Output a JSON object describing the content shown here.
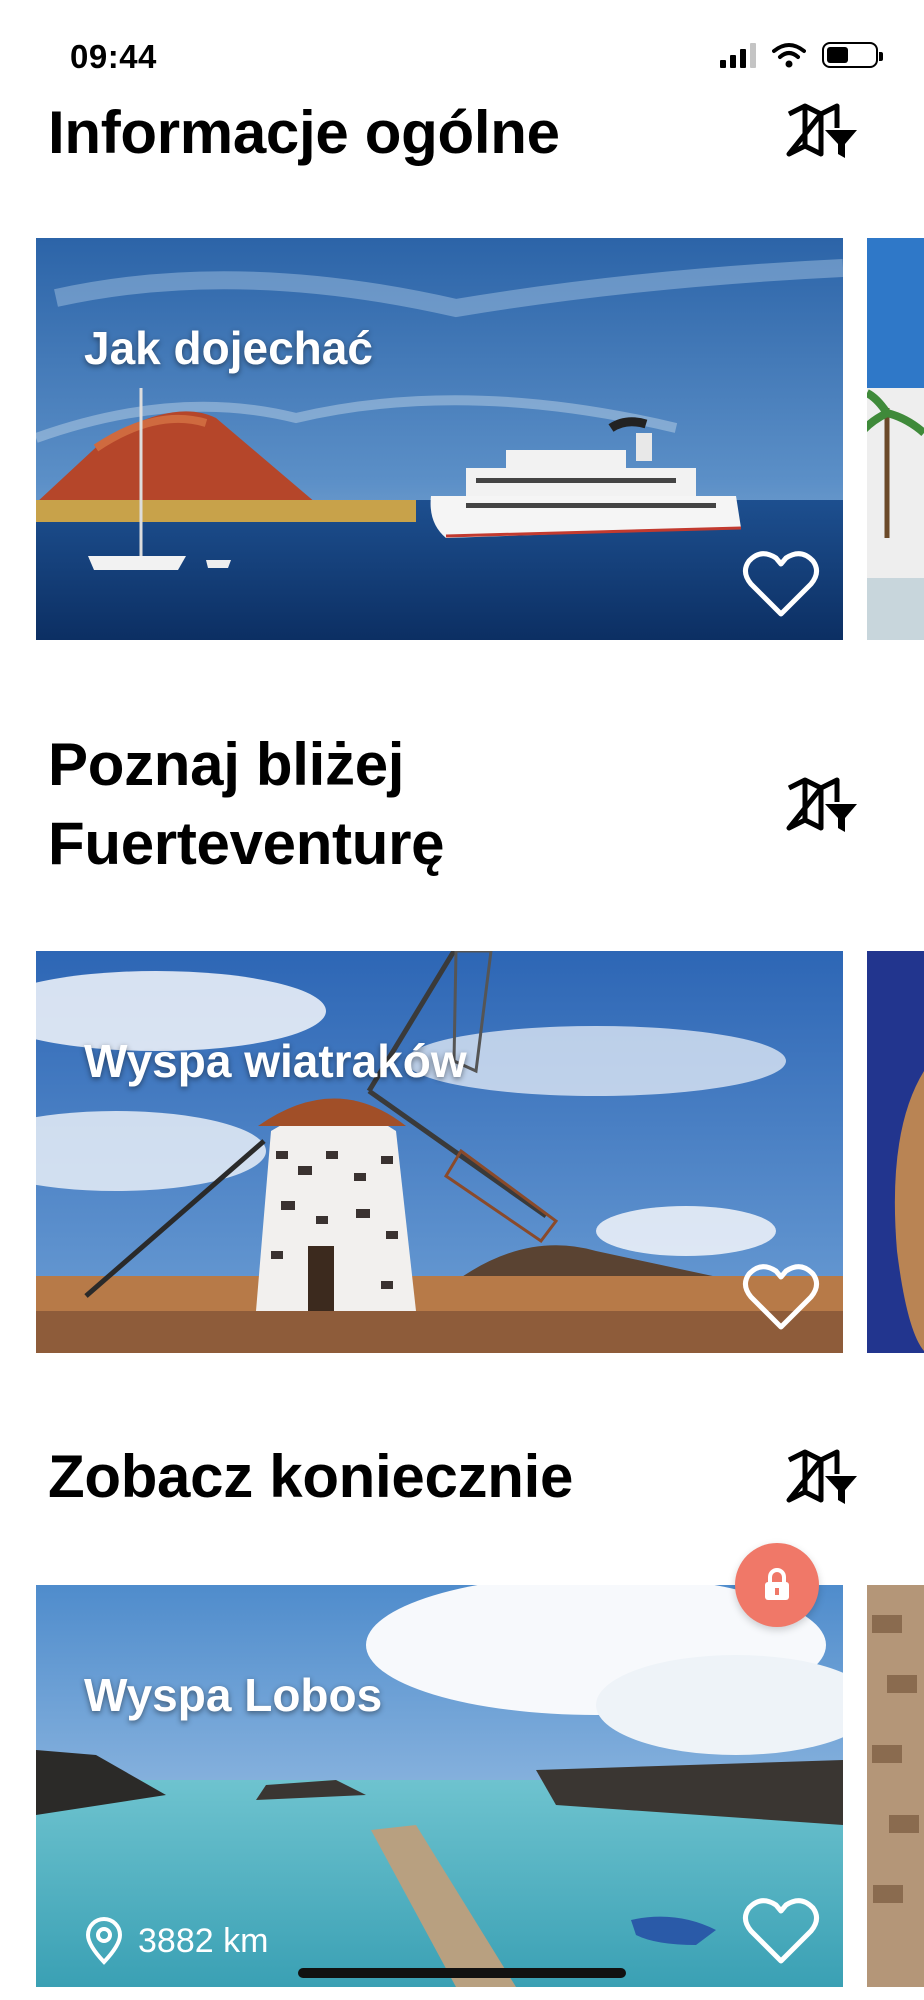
{
  "status_bar": {
    "time": "09:44"
  },
  "sections": [
    {
      "title_lines": [
        "Informacje ogólne"
      ],
      "card": {
        "label": "Jak dojechać"
      }
    },
    {
      "title_lines": [
        "Poznaj bliżej",
        "Fuerteventurę"
      ],
      "card": {
        "label": "Wyspa wiatraków"
      }
    },
    {
      "title_lines": [
        "Zobacz koniecznie"
      ],
      "card": {
        "label": "Wyspa Lobos",
        "distance": "3882 km"
      }
    }
  ],
  "icons": {
    "map": "map-filter-icon",
    "heart": "heart-outline-icon",
    "lock": "lock-icon",
    "location": "location-pin-icon"
  },
  "colors": {
    "lock_button": "#f07868",
    "text": "#000000",
    "background": "#ffffff"
  }
}
